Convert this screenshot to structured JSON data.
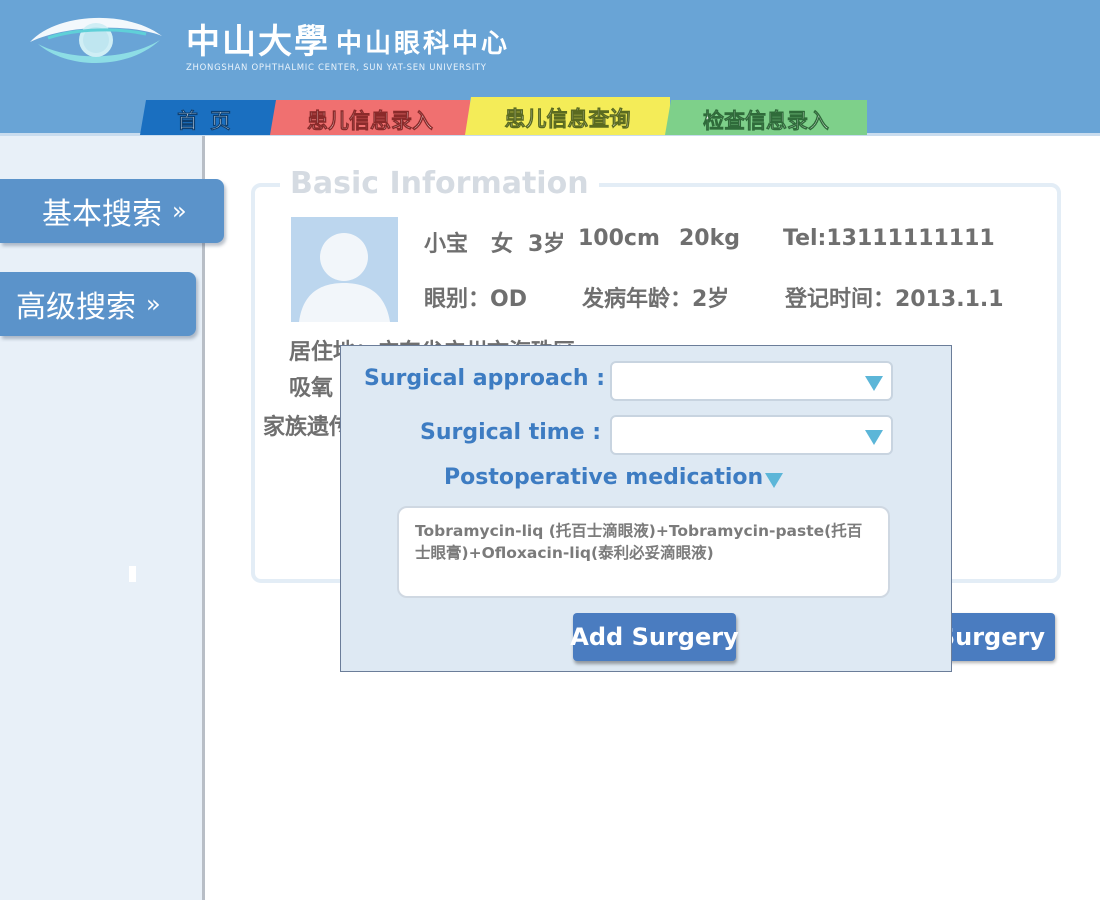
{
  "header": {
    "university": "中山大學",
    "center": "中山眼科中心",
    "subtitle": "ZHONGSHAN OPHTHALMIC CENTER, SUN YAT-SEN UNIVERSITY",
    "logo_icon": "eye-logo-icon"
  },
  "tabs": [
    {
      "label": "首页",
      "color": "#1a6fc0"
    },
    {
      "label": "患儿信息录入",
      "color": "#f07070"
    },
    {
      "label": "患儿信息查询",
      "color": "#f4ec58"
    },
    {
      "label": "检查信息录入",
      "color": "#7ed08a"
    }
  ],
  "sidebar": {
    "items": [
      {
        "label": "基本搜索",
        "chevron": "»"
      },
      {
        "label": "高级搜索",
        "chevron": "»"
      }
    ]
  },
  "basic_info": {
    "legend": "Basic Information",
    "name": "小宝",
    "gender": "女",
    "age": "3岁",
    "height": "100cm",
    "weight": "20kg",
    "tel": "Tel:13111111111",
    "eye": "眼别：OD",
    "onset_age": "发病年龄：2岁",
    "register_time": "登记时间：2013.1.1",
    "residence": "居住地：广东省广州市海珠区",
    "oxygen": "吸氧",
    "family": "家族遗传",
    "add_button": "Add Surgery"
  },
  "modal": {
    "approach_label": "Surgical approach :",
    "approach_value": "",
    "time_label": "Surgical time :",
    "time_value": "",
    "medication_label": "Postoperative medication",
    "medication_text": "Tobramycin-liq (托百士滴眼液)+Tobramycin-paste(托百士眼膏)+Ofloxacin-liq(泰利必妥滴眼液)",
    "add_button": "Add Surgery"
  },
  "colors": {
    "header_bg": "#69a4d6",
    "accent": "#3d7cc2",
    "button": "#4a7cc0",
    "caret": "#5cb6d8"
  }
}
